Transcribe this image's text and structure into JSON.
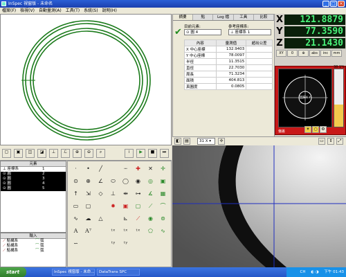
{
  "window": {
    "title": "InSpec 視窗版 - 未命名"
  },
  "menu": [
    "檔案(F)",
    "檢視(V)",
    "自動量測(A)",
    "工具(T)",
    "系統(S)",
    "說明(H)"
  ],
  "tabs": [
    "摘要",
    "點",
    "Log 檔",
    "工具",
    "比較"
  ],
  "summary": {
    "target_label": "目前元素:",
    "ref_label": "參考座標系:",
    "target_value": "圓 4",
    "ref_value": "座標系 1",
    "table_headers": [
      "內容",
      "量測值",
      "超出公差"
    ],
    "rows": [
      {
        "name": "X 中心座標",
        "value": "132.9403"
      },
      {
        "name": "Y 中心座標",
        "value": "78.0097"
      },
      {
        "name": "半徑",
        "value": "11.3515"
      },
      {
        "name": "直徑",
        "value": "22.7030"
      },
      {
        "name": "周長",
        "value": "71.3234"
      },
      {
        "name": "面積",
        "value": "404.813"
      },
      {
        "name": "真圓度",
        "value": "0.0805"
      }
    ]
  },
  "dro": [
    {
      "axis": "X",
      "value": "121.8879"
    },
    {
      "axis": "Y",
      "value": "77.3590"
    },
    {
      "axis": "Z",
      "value": "21.1430"
    }
  ],
  "dro_buttons": [
    "XY",
    "0",
    "⊕",
    "abs",
    "inc",
    "mm"
  ],
  "probe": {
    "percent": "38.1%",
    "center_text": "回歸X Y",
    "status": "偏差"
  },
  "camera": {
    "zoom": "31 X"
  },
  "elements": {
    "header": "元素",
    "items": [
      {
        "type": "座標系",
        "id": "1",
        "selected": false
      },
      {
        "type": "圓",
        "id": "2",
        "selected": true
      },
      {
        "type": "圓",
        "id": "3",
        "selected": true
      },
      {
        "type": "圓",
        "id": "4",
        "selected": true
      },
      {
        "type": "圓",
        "id": "5",
        "selected": true
      }
    ]
  },
  "inputs": {
    "header": "輸入",
    "items": [
      {
        "a": "點構系",
        "b": "弧"
      },
      {
        "a": "點構系",
        "b": "弧"
      },
      {
        "a": "點構系",
        "b": "弧"
      }
    ]
  },
  "taskbar": {
    "start": "start",
    "items": [
      "InSpec 視窗版 - 未命...",
      "DataTrans SPC"
    ],
    "tray": "CH",
    "clock": "下午 01:43"
  },
  "colors": {
    "circle_green": "#1a7a1a",
    "dro_bg": "#0a1f0a",
    "dro_text": "#49f27a",
    "probe_red": "#c81818",
    "crosshair": "#1e2dbf"
  }
}
